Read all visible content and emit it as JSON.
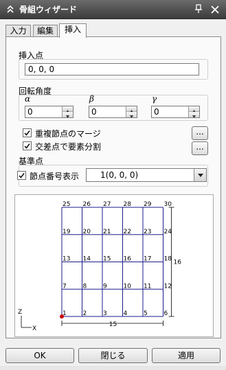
{
  "window": {
    "title": "骨組ウィザード",
    "icons": [
      "chevron-double-up-icon",
      "pin-icon",
      "close-icon"
    ]
  },
  "tabs": [
    {
      "label": "入力",
      "active": false
    },
    {
      "label": "編集",
      "active": false
    },
    {
      "label": "挿入",
      "active": true
    }
  ],
  "insert_point": {
    "label": "挿入点",
    "value": "0, 0, 0"
  },
  "rotation": {
    "label": "回転角度",
    "fields": [
      {
        "symbol": "α",
        "value": "0"
      },
      {
        "symbol": "β",
        "value": "0"
      },
      {
        "symbol": "γ",
        "value": "0"
      }
    ]
  },
  "options": {
    "merge_duplicate_nodes": {
      "label": "重複節点のマージ",
      "checked": true
    },
    "split_at_intersections": {
      "label": "交差点で要素分割",
      "checked": true
    },
    "ellipsis": "..."
  },
  "base_point": {
    "label": "基準点",
    "show_node_numbers": {
      "label": "節点番号表示",
      "checked": true
    },
    "selected": "1(0, 0, 0)"
  },
  "preview": {
    "node_labels": [
      [
        "25",
        "26",
        "27",
        "28",
        "29",
        "30"
      ],
      [
        "19",
        "20",
        "21",
        "22",
        "23",
        "24"
      ],
      [
        "13",
        "14",
        "15",
        "16",
        "17",
        "18"
      ],
      [
        "7",
        "8",
        "9",
        "10",
        "11",
        "12"
      ],
      [
        "1",
        "2",
        "3",
        "4",
        "5",
        "6"
      ]
    ],
    "width_dimension": "15",
    "height_dimension": "16",
    "axis_z": "Z",
    "axis_x": "X",
    "line_color": "#1a1a8c",
    "base_node_color": "#cc0000"
  },
  "buttons": {
    "ok": "OK",
    "close": "閉じる",
    "apply": "適用"
  }
}
